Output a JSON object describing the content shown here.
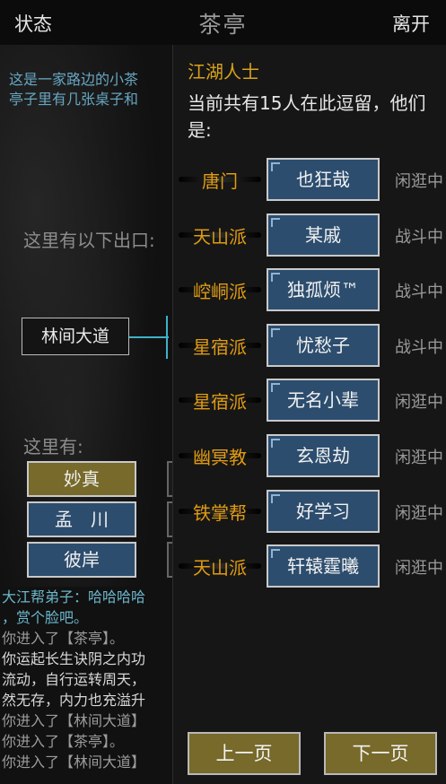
{
  "topbar": {
    "status": "状态",
    "title": "茶亭",
    "leave": "离开"
  },
  "scene": {
    "desc_lines": [
      "这是一家路边的小茶",
      "亭子里有几张桌子和"
    ],
    "exits_title": "这里有以下出口:",
    "exit": "林间大道",
    "here_title": "这里有:",
    "npcs": [
      "妙真",
      "孟　川",
      "彼岸"
    ]
  },
  "log": [
    "大江帮弟子：哈哈哈哈",
    "，赏个脸吧。",
    "你进入了【茶亭】。",
    "你运起长生诀阴之内功",
    "流动，自行运转周天，",
    "然无存，内力也充溢升",
    "你进入了【林间大道】",
    "你进入了【茶亭】。",
    "你进入了【林间大道】"
  ],
  "panel": {
    "title": "江湖人士",
    "info": "当前共有15人在此逗留，他们是:",
    "players": [
      {
        "sect": "唐门",
        "name": "也狂哉",
        "state": "闲逛中"
      },
      {
        "sect": "天山派",
        "name": "某戚",
        "state": "战斗中"
      },
      {
        "sect": "崆峒派",
        "name": "独孤烦™",
        "state": "战斗中"
      },
      {
        "sect": "星宿派",
        "name": "忧愁子",
        "state": "战斗中"
      },
      {
        "sect": "星宿派",
        "name": "无名小辈",
        "state": "闲逛中"
      },
      {
        "sect": "幽冥教",
        "name": "玄恩劫",
        "state": "闲逛中"
      },
      {
        "sect": "铁掌帮",
        "name": "好学习",
        "state": "闲逛中"
      },
      {
        "sect": "天山派",
        "name": "轩辕霆曦",
        "state": "闲逛中"
      }
    ],
    "prev": "上一页",
    "next": "下一页"
  },
  "colors": {
    "sect": "#e09b12",
    "title": "#d9a21b",
    "button_blue": "#2c4d6e",
    "button_gold": "#776a2a",
    "desc": "#67a6c2"
  }
}
